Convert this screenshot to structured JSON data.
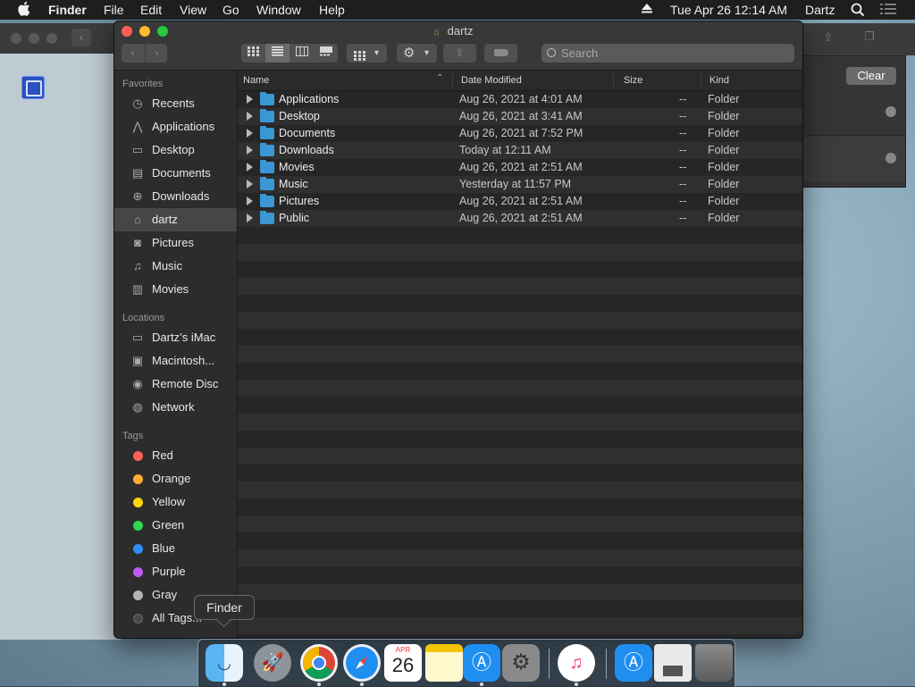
{
  "menubar": {
    "apple": "",
    "app": "Finder",
    "menus": [
      "File",
      "Edit",
      "View",
      "Go",
      "Window",
      "Help"
    ],
    "datetime": "Tue Apr 26  12:14 AM",
    "user": "Dartz"
  },
  "bg_window": {
    "clear_label": "Clear"
  },
  "window": {
    "title": "dartz",
    "search_placeholder": "Search"
  },
  "sidebar": {
    "favorites_title": "Favorites",
    "favorites": [
      {
        "label": "Recents",
        "icon": "clock-icon"
      },
      {
        "label": "Applications",
        "icon": "applications-icon"
      },
      {
        "label": "Desktop",
        "icon": "desktop-icon"
      },
      {
        "label": "Documents",
        "icon": "document-icon"
      },
      {
        "label": "Downloads",
        "icon": "download-icon"
      },
      {
        "label": "dartz",
        "icon": "home-icon",
        "selected": true
      },
      {
        "label": "Pictures",
        "icon": "camera-icon"
      },
      {
        "label": "Music",
        "icon": "music-note-icon"
      },
      {
        "label": "Movies",
        "icon": "film-icon"
      }
    ],
    "locations_title": "Locations",
    "locations": [
      {
        "label": "Dartz’s iMac",
        "icon": "imac-icon"
      },
      {
        "label": "Macintosh...",
        "icon": "hard-drive-icon"
      },
      {
        "label": "Remote Disc",
        "icon": "disc-icon"
      },
      {
        "label": "Network",
        "icon": "globe-icon"
      }
    ],
    "tags_title": "Tags",
    "tags": [
      {
        "label": "Red",
        "color": "#ff5f57"
      },
      {
        "label": "Orange",
        "color": "#ffae35"
      },
      {
        "label": "Yellow",
        "color": "#ffd60a"
      },
      {
        "label": "Green",
        "color": "#32d74b"
      },
      {
        "label": "Blue",
        "color": "#2f8cf5"
      },
      {
        "label": "Purple",
        "color": "#bf5af2"
      },
      {
        "label": "Gray",
        "color": "#b5b5b5"
      },
      {
        "label": "All Tags...",
        "color": "#6a6a6a"
      }
    ]
  },
  "columns": {
    "name": "Name",
    "date": "Date Modified",
    "size": "Size",
    "kind": "Kind"
  },
  "files": [
    {
      "name": "Applications",
      "date": "Aug 26, 2021 at 4:01 AM",
      "size": "--",
      "kind": "Folder"
    },
    {
      "name": "Desktop",
      "date": "Aug 26, 2021 at 3:41 AM",
      "size": "--",
      "kind": "Folder"
    },
    {
      "name": "Documents",
      "date": "Aug 26, 2021 at 7:52 PM",
      "size": "--",
      "kind": "Folder"
    },
    {
      "name": "Downloads",
      "date": "Today at 12:11 AM",
      "size": "--",
      "kind": "Folder"
    },
    {
      "name": "Movies",
      "date": "Aug 26, 2021 at 2:51 AM",
      "size": "--",
      "kind": "Folder"
    },
    {
      "name": "Music",
      "date": "Yesterday at 11:57 PM",
      "size": "--",
      "kind": "Folder"
    },
    {
      "name": "Pictures",
      "date": "Aug 26, 2021 at 2:51 AM",
      "size": "--",
      "kind": "Folder"
    },
    {
      "name": "Public",
      "date": "Aug 26, 2021 at 2:51 AM",
      "size": "--",
      "kind": "Folder"
    }
  ],
  "tooltip": "Finder",
  "dock": {
    "calendar_month": "APR",
    "calendar_day": "26"
  }
}
